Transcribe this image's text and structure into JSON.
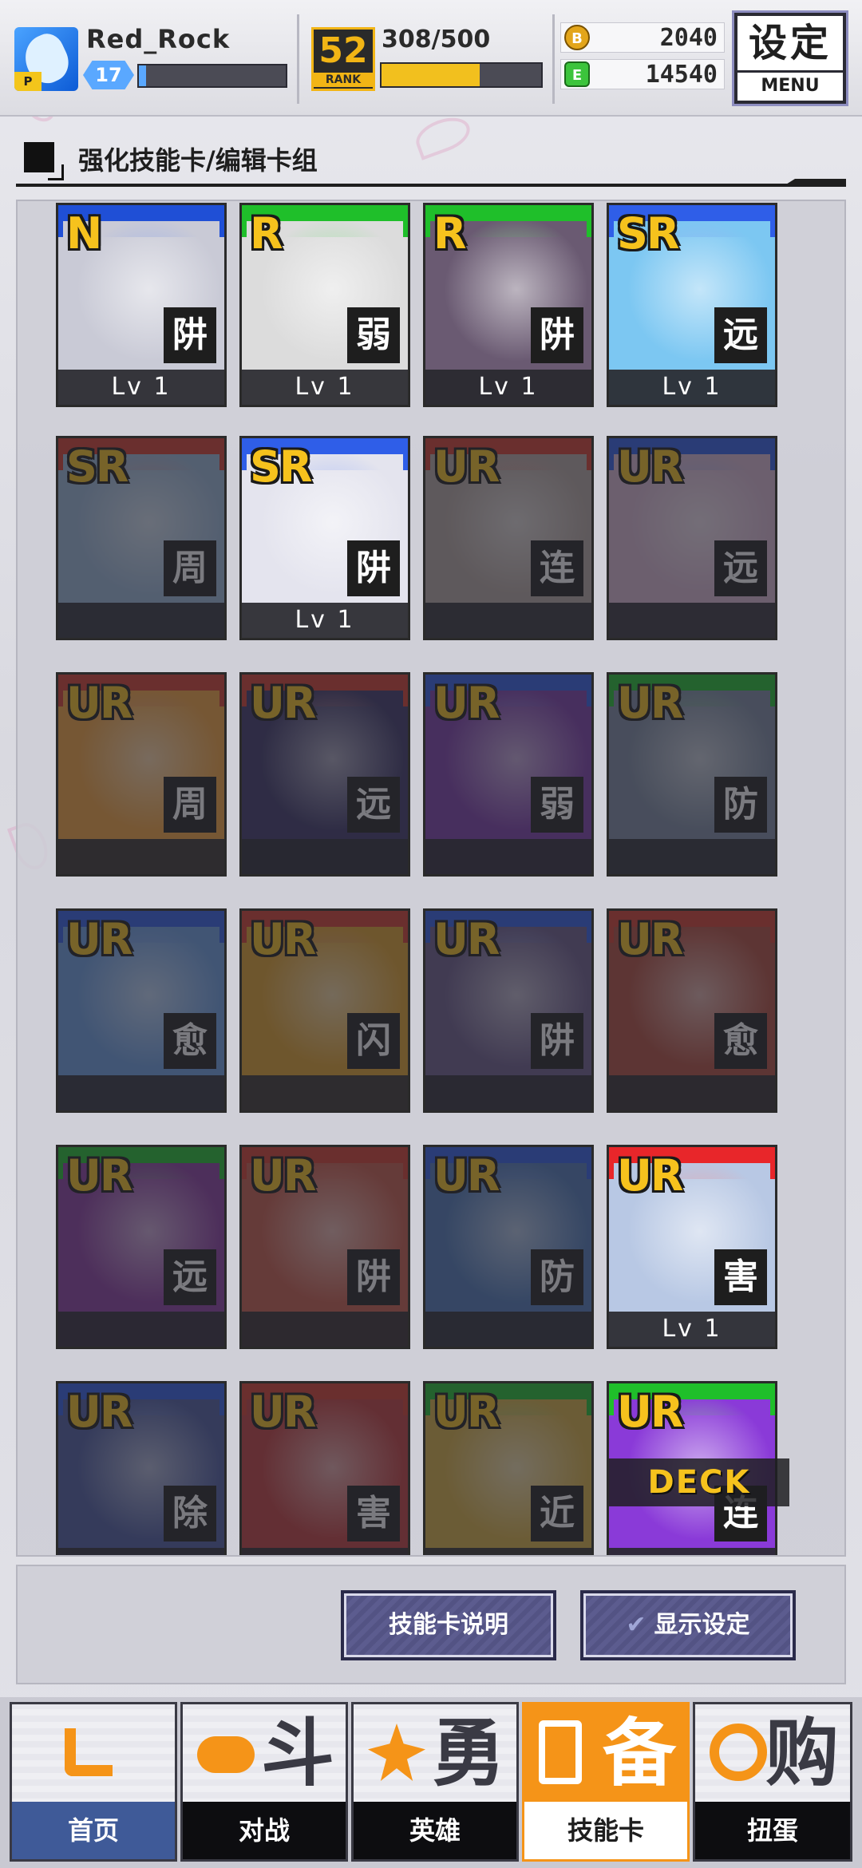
{
  "header": {
    "player_name": "Red_Rock",
    "avatar_badge": "P",
    "level": "17",
    "xp_fraction": 0.05,
    "rank_number": "52",
    "rank_label": "RANK",
    "rank_progress_text": "308/500",
    "rank_progress_fraction": 0.616,
    "coin_icon": "B",
    "coins": "2040",
    "energy_icon": "E",
    "energy": "14540",
    "menu_cn": "设定",
    "menu_en": "MENU"
  },
  "section": {
    "title": "强化技能卡/编辑卡组"
  },
  "cards": [
    {
      "rarity": "N",
      "type": "阱",
      "level": "Lv 1",
      "band": "#1f4fd6",
      "art": "#c9cad6",
      "locked": false
    },
    {
      "rarity": "R",
      "type": "弱",
      "level": "Lv 1",
      "band": "#1fbf2a",
      "art": "#dcdcdc",
      "locked": false
    },
    {
      "rarity": "R",
      "type": "阱",
      "level": "Lv 1",
      "band": "#1fbf2a",
      "art": "#6a5a72",
      "locked": false
    },
    {
      "rarity": "SR",
      "type": "远",
      "level": "Lv 1",
      "band": "#2f5ee8",
      "art": "#7cc7f2",
      "locked": false
    },
    {
      "rarity": "SR",
      "type": "周",
      "level": "",
      "band": "#d63a2a",
      "art": "#9ab8d8",
      "locked": true
    },
    {
      "rarity": "SR",
      "type": "阱",
      "level": "Lv 1",
      "band": "#2f5ee8",
      "art": "#e4e4ee",
      "locked": false
    },
    {
      "rarity": "UR",
      "type": "连",
      "level": "",
      "band": "#d63a2a",
      "art": "#b6a8a2",
      "locked": true
    },
    {
      "rarity": "UR",
      "type": "远",
      "level": "",
      "band": "#2f5ee8",
      "art": "#d9b7d2",
      "locked": true
    },
    {
      "rarity": "UR",
      "type": "周",
      "level": "",
      "band": "#d63a2a",
      "art": "#f3a23a",
      "locked": true
    },
    {
      "rarity": "UR",
      "type": "远",
      "level": "",
      "band": "#d63a2a",
      "art": "#3a3466",
      "locked": true
    },
    {
      "rarity": "UR",
      "type": "弱",
      "level": "",
      "band": "#2f5ee8",
      "art": "#7a3aa8",
      "locked": true
    },
    {
      "rarity": "UR",
      "type": "防",
      "level": "",
      "band": "#1fbf2a",
      "art": "#7b8aa2",
      "locked": true
    },
    {
      "rarity": "UR",
      "type": "愈",
      "level": "",
      "band": "#2f5ee8",
      "art": "#6a9ee2",
      "locked": true
    },
    {
      "rarity": "UR",
      "type": "闪",
      "level": "",
      "band": "#d63a2a",
      "art": "#e0a028",
      "locked": true
    },
    {
      "rarity": "UR",
      "type": "阱",
      "level": "",
      "band": "#2f5ee8",
      "art": "#6a5a8a",
      "locked": true
    },
    {
      "rarity": "UR",
      "type": "愈",
      "level": "",
      "band": "#d63a2a",
      "art": "#b24a3a",
      "locked": true
    },
    {
      "rarity": "UR",
      "type": "远",
      "level": "",
      "band": "#1fbf2a",
      "art": "#8a3aa0",
      "locked": true
    },
    {
      "rarity": "UR",
      "type": "阱",
      "level": "",
      "band": "#d63a2a",
      "art": "#c95a48",
      "locked": true
    },
    {
      "rarity": "UR",
      "type": "防",
      "level": "",
      "band": "#2f5ee8",
      "art": "#4c78b8",
      "locked": true
    },
    {
      "rarity": "UR",
      "type": "害",
      "level": "Lv 1",
      "band": "#e8262a",
      "art": "#b8c8e4",
      "locked": false
    },
    {
      "rarity": "UR",
      "type": "除",
      "level": "",
      "band": "#2f5ee8",
      "art": "#4a5aa0",
      "locked": true
    },
    {
      "rarity": "UR",
      "type": "害",
      "level": "",
      "band": "#d63a2a",
      "art": "#c23a3a",
      "locked": true
    },
    {
      "rarity": "UR",
      "type": "近",
      "level": "",
      "band": "#1fbf2a",
      "art": "#d8b040",
      "locked": true
    },
    {
      "rarity": "UR",
      "type": "连",
      "level": "",
      "band": "#1fbf2a",
      "art": "#8a3ad8",
      "locked": false,
      "deck": "DECK"
    }
  ],
  "actions": {
    "skill_card_help": "技能卡说明",
    "display_settings": "显示设定"
  },
  "nav": [
    {
      "big": "",
      "label": "首页",
      "icon": "back-arrow-icon",
      "active": false
    },
    {
      "big": "斗",
      "label": "对战",
      "icon": "gamepad-icon",
      "active": false
    },
    {
      "big": "勇",
      "label": "英雄",
      "icon": "hero-icon",
      "active": false
    },
    {
      "big": "备",
      "label": "技能卡",
      "icon": "cards-icon",
      "active": true
    },
    {
      "big": "购",
      "label": "扭蛋",
      "icon": "capsule-icon",
      "active": false
    }
  ],
  "colors": {
    "accent_orange": "#f59418",
    "gold": "#f2c01e",
    "xp_blue": "#5aa8ff",
    "button_purple": "#5c5c8f"
  }
}
